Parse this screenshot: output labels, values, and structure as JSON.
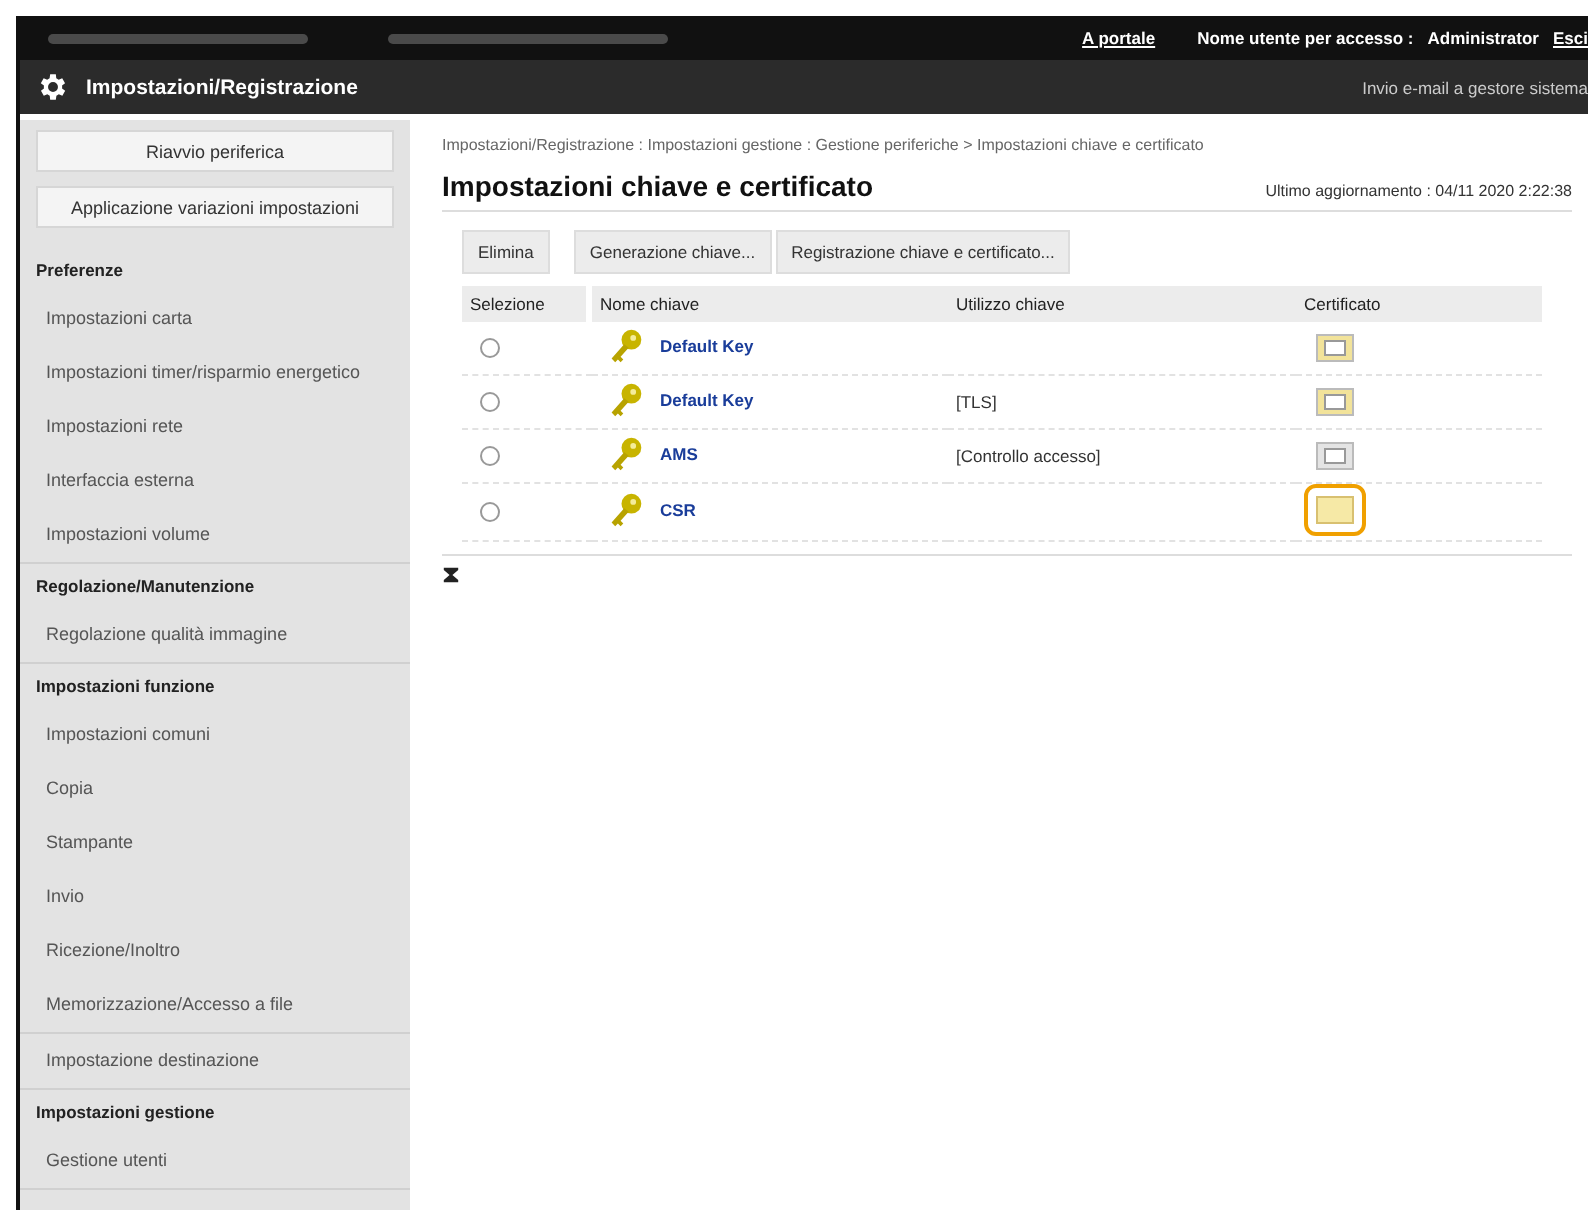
{
  "top_bar": {
    "links": [
      "A portale"
    ],
    "user_label": "Nome utente per accesso :",
    "user_name": "Administrator",
    "logout": "Esci"
  },
  "title_bar": {
    "title": "Impostazioni/Registrazione",
    "link": "Invio e-mail a gestore sistema"
  },
  "sidebar": {
    "buttons": [
      "Riavvio periferica",
      "Applicazione variazioni impostazioni"
    ],
    "sections": [
      {
        "title": "Preferenze",
        "items": [
          "Impostazioni carta",
          "Impostazioni timer/risparmio energetico",
          "Impostazioni rete",
          "Interfaccia esterna",
          "Impostazioni volume"
        ]
      },
      {
        "title": "Regolazione/Manutenzione",
        "items": [
          "Regolazione qualità immagine"
        ]
      },
      {
        "title": "Impostazioni funzione",
        "items": [
          "Impostazioni comuni",
          "Copia",
          "Stampante",
          "Invio",
          "Ricezione/Inoltro",
          "Memorizzazione/Accesso a file"
        ]
      },
      {
        "items": [
          "Impostazione destinazione"
        ]
      },
      {
        "title": "Impostazioni gestione",
        "items": [
          "Gestione utenti"
        ]
      }
    ]
  },
  "breadcrumb": "Impostazioni/Registrazione : Impostazioni gestione : Gestione periferiche > Impostazioni chiave e certificato",
  "page_title": "Impostazioni chiave e certificato",
  "last_update": "Ultimo aggiornamento : 04/11 2020 2:22:38",
  "toolbar": [
    "Elimina",
    "Generazione chiave...",
    "Registrazione chiave e certificato..."
  ],
  "table": {
    "columns": [
      "Selezione",
      "Nome chiave",
      "Utilizzo chiave",
      "Certificato"
    ],
    "rows": [
      {
        "selected": false,
        "name": "Default Key",
        "usage": "",
        "certificate": {
          "kind": "valid"
        },
        "highlighted": false
      },
      {
        "selected": false,
        "name": "Default Key",
        "usage": "[TLS]",
        "certificate": {
          "kind": "valid"
        },
        "highlighted": false
      },
      {
        "selected": false,
        "name": "AMS",
        "usage": "[Controllo accesso]",
        "certificate": {
          "kind": "inactive"
        },
        "highlighted": false
      },
      {
        "selected": false,
        "name": "CSR",
        "usage": "",
        "certificate": {
          "kind": "blank"
        },
        "highlighted": true
      }
    ]
  }
}
